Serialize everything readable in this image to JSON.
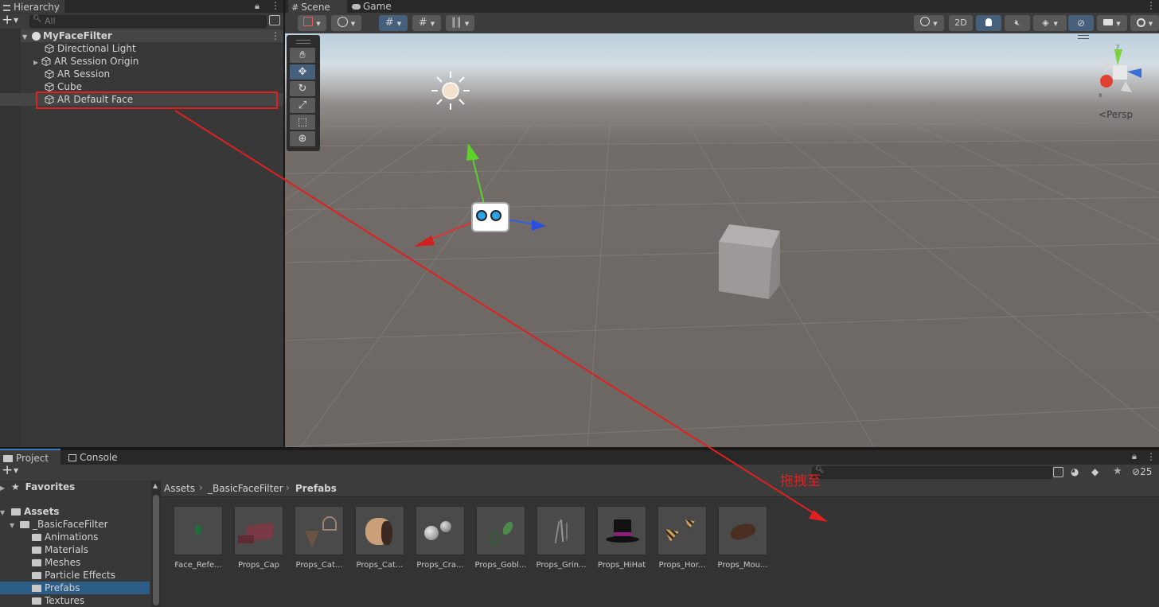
{
  "hierarchy": {
    "tab_label": "Hierarchy",
    "search_placeholder": "All",
    "scene_name": "MyFaceFilter",
    "items": [
      {
        "label": "Directional Light"
      },
      {
        "label": "AR Session Origin"
      },
      {
        "label": "AR Session"
      },
      {
        "label": "Cube"
      },
      {
        "label": "AR Default Face"
      }
    ]
  },
  "scene_view": {
    "tabs": [
      {
        "label": "Scene"
      },
      {
        "label": "Game"
      }
    ],
    "toolbar": {
      "mode_2d_label": "2D"
    },
    "projection_label": "Persp",
    "gizmo_axis_x_label": "x",
    "gizmo_axis_y_label": "y"
  },
  "project": {
    "tabs": [
      {
        "label": "Project"
      },
      {
        "label": "Console"
      }
    ],
    "favorites_label": "Favorites",
    "assets_label": "Assets",
    "tree": [
      {
        "label": "_BasicFaceFilter"
      },
      {
        "label": "Animations"
      },
      {
        "label": "Materials"
      },
      {
        "label": "Meshes"
      },
      {
        "label": "Particle Effects"
      },
      {
        "label": "Prefabs"
      },
      {
        "label": "Textures"
      }
    ],
    "breadcrumb": [
      "Assets",
      "_BasicFaceFilter",
      "Prefabs"
    ],
    "hidden_count": "25",
    "assets": [
      {
        "label": "Face_Refe...",
        "icon": "face-reference-thumb"
      },
      {
        "label": "Props_Cap",
        "icon": "cap-thumb"
      },
      {
        "label": "Props_Cat...",
        "icon": "cat-ears-thumb"
      },
      {
        "label": "Props_Cat...",
        "icon": "cat-nose-thumb"
      },
      {
        "label": "Props_Cra...",
        "icon": "spheres-thumb"
      },
      {
        "label": "Props_Gobl...",
        "icon": "goblin-ears-thumb"
      },
      {
        "label": "Props_Grin...",
        "icon": "grin-thumb"
      },
      {
        "label": "Props_HiHat",
        "icon": "hihat-thumb"
      },
      {
        "label": "Props_Hor...",
        "icon": "horns-thumb"
      },
      {
        "label": "Props_Mou...",
        "icon": "mouse-thumb"
      }
    ]
  },
  "annotation": {
    "label": "拖拽至",
    "color": "#e02020"
  },
  "colors": {
    "selection": "#2c5d87",
    "highlight_box": "#e02020",
    "scene_ground": "#726c69",
    "scene_sky": "#bcd0de"
  }
}
